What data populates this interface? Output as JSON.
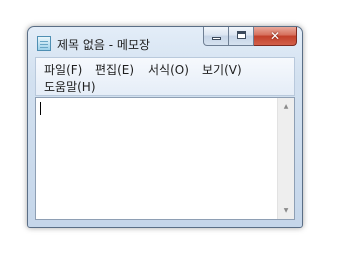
{
  "window": {
    "title": "제목 없음 - 메모장"
  },
  "caption_buttons": {
    "minimize_icon": "minimize-icon",
    "maximize_icon": "maximize-icon",
    "close_glyph": "✕"
  },
  "menu": {
    "items": [
      {
        "label": "파일(F)"
      },
      {
        "label": "편집(E)"
      },
      {
        "label": "서식(O)"
      },
      {
        "label": "보기(V)"
      },
      {
        "label": "도움말(H)"
      }
    ]
  },
  "editor": {
    "text": ""
  },
  "scrollbar": {
    "up_arrow": "▲",
    "down_arrow": "▼"
  }
}
